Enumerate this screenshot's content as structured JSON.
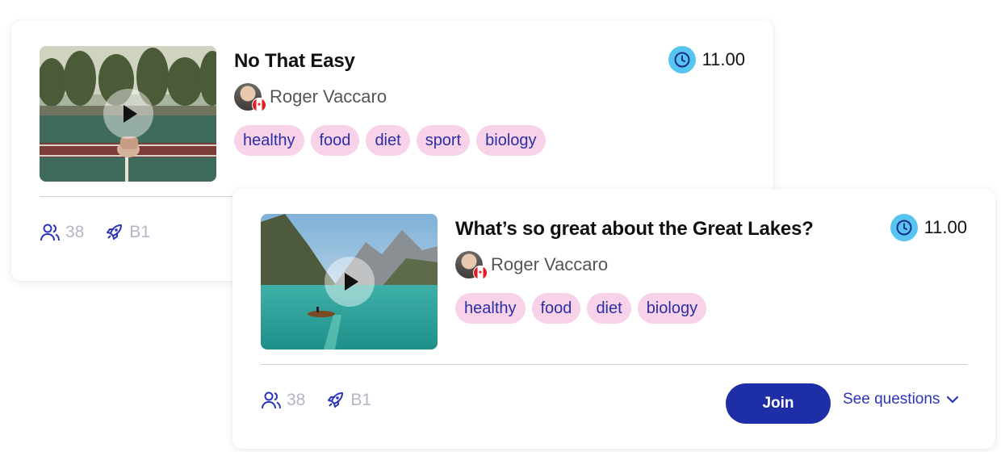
{
  "cards": [
    {
      "title": "No That Easy",
      "author": "Roger Vaccaro",
      "duration": "11.00",
      "tags": [
        "healthy",
        "food",
        "diet",
        "sport",
        "biology"
      ],
      "participants": "38",
      "level": "B1",
      "icons": {
        "duration": "clock-icon",
        "participants": "users-icon",
        "level": "rocket-icon",
        "video": "play-icon"
      }
    },
    {
      "title": "What’s so great about the Great Lakes?",
      "author": "Roger Vaccaro",
      "duration": "11.00",
      "tags": [
        "healthy",
        "food",
        "diet",
        "biology"
      ],
      "participants": "38",
      "level": "B1",
      "join_label": "Join",
      "see_questions_label": "See questions",
      "icons": {
        "duration": "clock-icon",
        "participants": "users-icon",
        "level": "rocket-icon",
        "video": "play-icon",
        "expand": "chevron-down-icon"
      }
    }
  ],
  "colors": {
    "accent": "#1d2ea6",
    "tag_bg": "#f7d2e9",
    "tag_text": "#2b2fa6",
    "clock": "#56c6f0",
    "muted": "#b3b6c4"
  }
}
